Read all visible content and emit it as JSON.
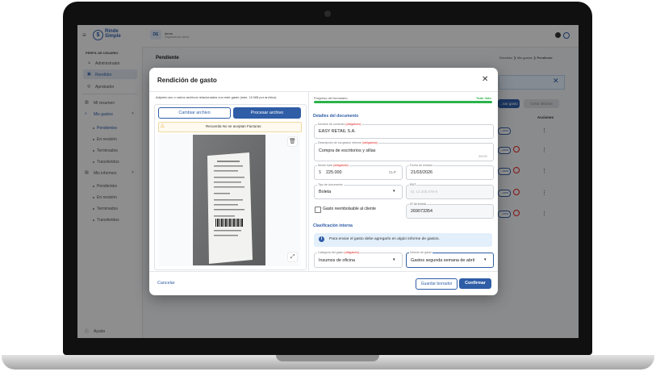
{
  "colors": {
    "primary": "#2f5da6",
    "progress": "#2bb34a",
    "required": "#d22222",
    "info_bg": "#e3effb"
  },
  "topbar": {
    "logo_line1": "Rinde",
    "logo_line2": "Simple",
    "avatar_initials": "DE",
    "user_name": "demo",
    "user_org": "Organización demo"
  },
  "sidebar": {
    "profile_heading": "PERFIL DE USUARIO",
    "roles": [
      {
        "label": "Administrador",
        "icon": "person-icon"
      },
      {
        "label": "Rendidor",
        "icon": "receipt-icon"
      },
      {
        "label": "Aprobador",
        "icon": "check-circle-icon"
      }
    ],
    "summary": "Mi resumen",
    "expenses": "Mis gastos",
    "expense_items": [
      "Pendientes",
      "En revisión",
      "Terminados",
      "Transferidos"
    ],
    "reports": "Mis informes",
    "report_items": [
      "Pendientes",
      "En revisión",
      "Terminados",
      "Transferidos"
    ],
    "help": "Ayuda"
  },
  "main": {
    "page_title": "Pendiente",
    "breadcrumb": [
      "Rendidor",
      "Mis gastos",
      "Pendiente"
    ],
    "add_button": "...nar gasto",
    "create_report_button": "Crear informe",
    "actions_header": "Acciones",
    "row_badge": "...orna"
  },
  "modal": {
    "title": "Rendición de gasto",
    "attach_hint": "Adjunta uno o varios archivos relacionados con este gasto (máx. 10 MB por archivo)",
    "change_file": "Cambiar archivo",
    "process_file": "Procesar archivo",
    "warning": "Recuerda No se aceptan Facturas",
    "progress_label": "Progreso del formulario",
    "progress_status": "Todo listo",
    "progress_value": 1.0,
    "section_details": "Detalles del documento",
    "merchant_label": "Nombre de comercio",
    "merchant_value": "EASY RETAIL S.A.",
    "description_label": "Descripción de los gastos informe",
    "description_value": "Compra de escritorios y sillas",
    "description_counter": "30/100",
    "amount_label": "Monto total",
    "amount_currency_symbol": "$",
    "amount_value": "225.000",
    "currency": "CLP",
    "date_label": "Fecha de emisión",
    "date_value": "21/03/2026",
    "doc_type_label": "Tipo de documento",
    "doc_type_value": "Boleta",
    "rut_label": "RUT",
    "rut_placeholder": "Ej: 12.345.678-9",
    "reimbursable_label": "Gasto reembolsable al cliente",
    "doc_number_label": "N° de boleta",
    "doc_number_value": "269073354",
    "required_tag": "(obligatorio)",
    "section_classification": "Clasificación interna",
    "info_text": "Para enviar el gasto debe agregarlo en algún informe de gastos.",
    "category_label": "Categoría del gasto",
    "category_value": "Insumos de oficina",
    "report_label": "Informe de gasto",
    "report_value": "Gastos segunda semana de abril",
    "cancel": "Cancelar",
    "save_draft": "Guardar borrador",
    "confirm": "Confirmar"
  }
}
